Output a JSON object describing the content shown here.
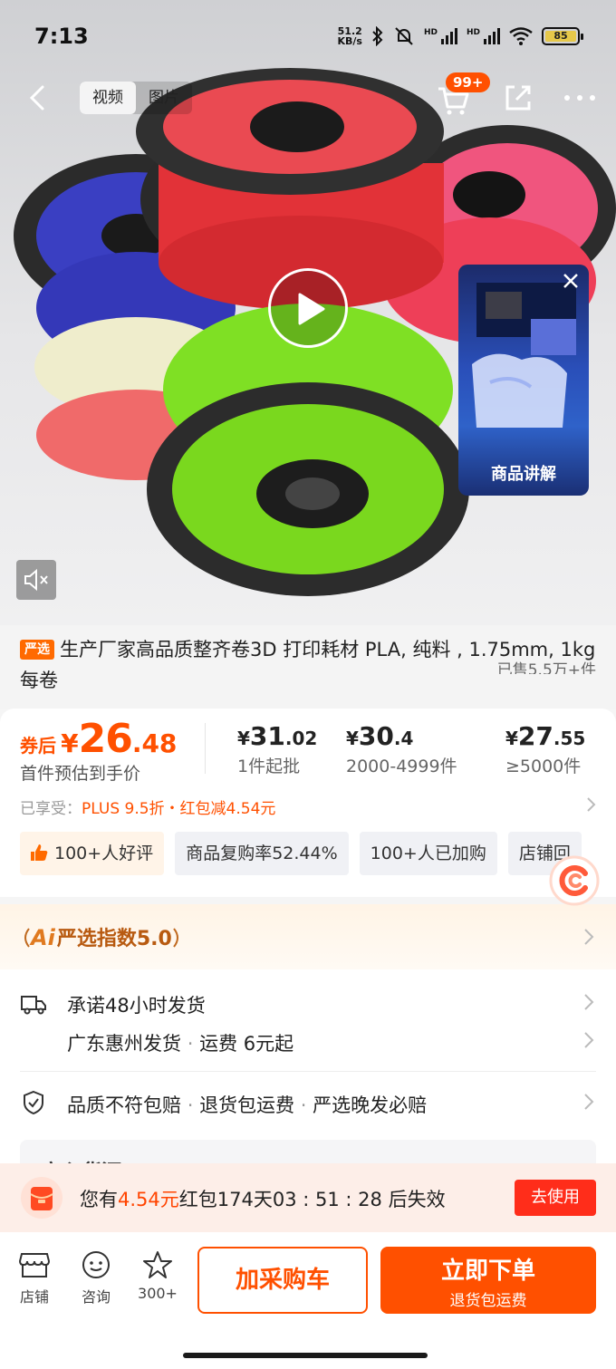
{
  "status_bar": {
    "time": "7:13",
    "net_speed_value": "51.2",
    "net_speed_unit": "KB/s",
    "hd1": "HD",
    "hd2": "HD",
    "battery": "85",
    "icons": [
      "bluetooth-icon",
      "mute-bell-icon",
      "signal-icon",
      "signal-icon",
      "wifi-icon",
      "battery-icon"
    ]
  },
  "top_nav": {
    "tab_video": "视频",
    "tab_images": "图片",
    "cart_badge": "99+"
  },
  "media": {
    "popup_label": "商品讲解",
    "colors": {
      "brand": "#ff5000",
      "red_spool": "#e8323a",
      "blue_spool": "#3438b8",
      "green_spool": "#7fe024",
      "pink_spool": "#f0507a",
      "natural_spool": "#eeecc9"
    }
  },
  "product": {
    "tag": "严选",
    "title": "生产厂家高品质整齐卷3D 打印耗材 PLA, 纯料 , 1.75mm, 1kg 每卷",
    "sold": "已售5.5万+件"
  },
  "price": {
    "main_label": "券后",
    "currency": "¥",
    "main_int": "26",
    "main_dec": ".48",
    "main_sub": "首件预估到手价",
    "tiers": [
      {
        "int": "31",
        "dec": ".02",
        "qty": "1件起批"
      },
      {
        "int": "30",
        "dec": ".4",
        "qty": "2000-4999件"
      },
      {
        "int": "27",
        "dec": ".55",
        "qty": "≥5000件"
      }
    ],
    "enjoy_label": "已享受：",
    "enjoy_value": "PLUS 9.5折・红包减4.54元"
  },
  "chips": [
    "100+人好评",
    "商品复购率52.44%",
    "100+人已加购",
    "店铺回"
  ],
  "ai_index": {
    "ai": "Ai",
    "label": "严选指数5.0"
  },
  "services": {
    "ship_promise": "承诺48小时发货",
    "ship_origin": "广东惠州发货",
    "ship_fee": "运费 6元起",
    "sep": "·",
    "guarantee1": "品质不符包赔",
    "guarantee2": "退货包运费",
    "guarantee3": "严选晚发必赔",
    "peek_title": "安心货源"
  },
  "red_packet": {
    "prefix": "您有",
    "amount": "4.54元",
    "middle": "红包174天",
    "countdown": "03 : 51 : 28",
    "suffix": "后失效",
    "button": "去使用"
  },
  "bottom_bar": {
    "store": "店铺",
    "consult": "咨询",
    "fav_count": "300+",
    "add_cart": "加采购车",
    "buy_now": "立即下单",
    "buy_sub": "退货包运费"
  }
}
